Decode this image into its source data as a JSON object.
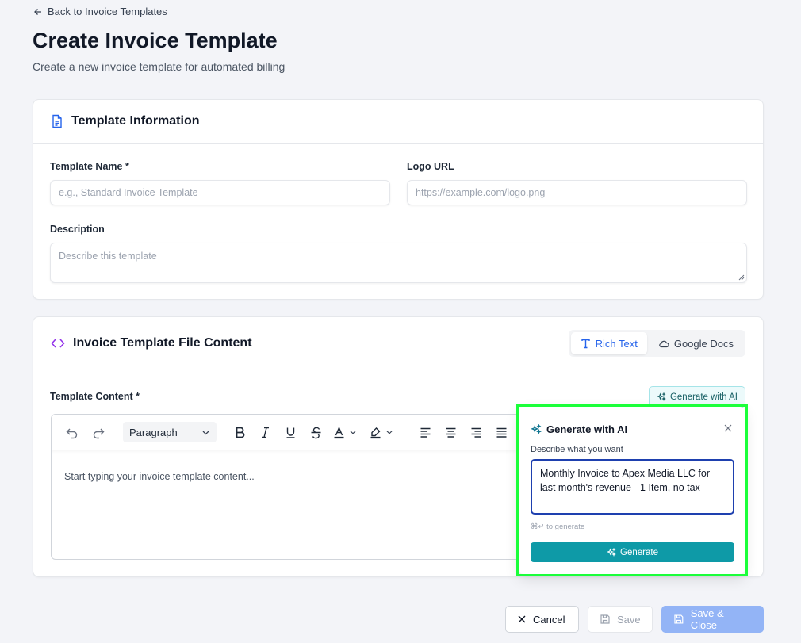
{
  "page": {
    "back_link": "Back to Invoice Templates",
    "title": "Create Invoice Template",
    "subtitle": "Create a new invoice template for automated billing"
  },
  "template_info": {
    "title": "Template Information",
    "name_label": "Template Name *",
    "name_placeholder": "e.g., Standard Invoice Template",
    "logo_label": "Logo URL",
    "logo_placeholder": "https://example.com/logo.png",
    "description_label": "Description",
    "description_placeholder": "Describe this template"
  },
  "file_content": {
    "title": "Invoice Template File Content",
    "tabs": [
      {
        "label": "Rich Text",
        "active": true
      },
      {
        "label": "Google Docs",
        "active": false
      }
    ],
    "content_label": "Template Content *",
    "generate_ai_label": "Generate with AI",
    "toolbar": {
      "block_type": "Paragraph"
    },
    "editor_placeholder": "Start typing your invoice template content..."
  },
  "ai_popover": {
    "title": "Generate with AI",
    "prompt_label": "Describe what you want",
    "prompt_value": "Monthly Invoice to Apex Media LLC for last month's revenue - 1 Item, no tax",
    "hint": "⌘↵ to generate",
    "generate_label": "Generate"
  },
  "footer": {
    "cancel_label": "Cancel",
    "save_label": "Save",
    "save_close_label": "Save & Close"
  },
  "colors": {
    "accent_blue": "#2563eb",
    "teal": "#0e9aa7",
    "highlight": "#1bff3a",
    "purple_icon": "#9333ea"
  }
}
